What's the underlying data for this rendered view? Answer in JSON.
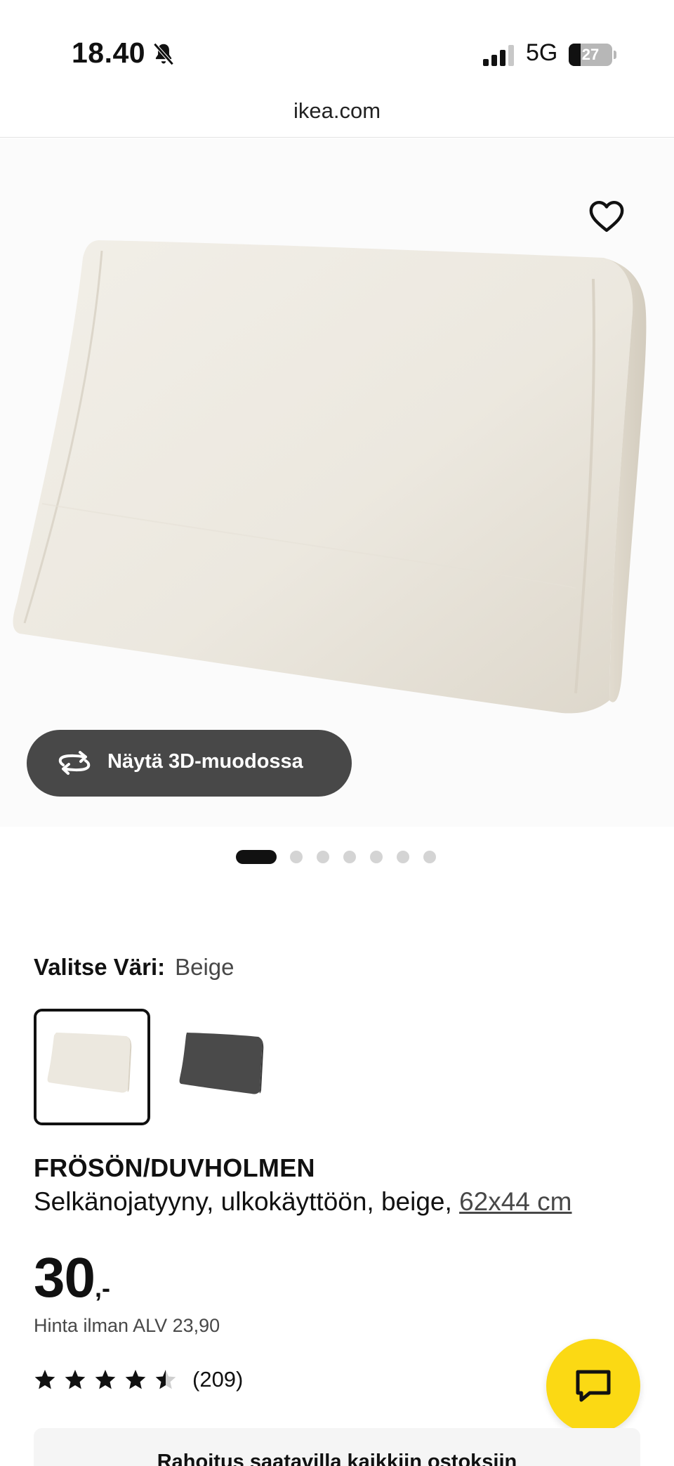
{
  "status_bar": {
    "time": "18.40",
    "network": "5G",
    "battery": "27",
    "battery_level_percent": 27,
    "icons": [
      "bell-slash-icon",
      "signal-icon",
      "battery-icon"
    ]
  },
  "browser": {
    "url": "ikea.com"
  },
  "gallery": {
    "view_3d_label": "Näytä 3D-muodossa",
    "dot_count": 7,
    "active_dot": 0,
    "icons": [
      "heart-icon",
      "rotate-3d-icon"
    ]
  },
  "color_picker": {
    "label": "Valitse Väri:",
    "selected": "Beige",
    "swatches": [
      {
        "name": "beige",
        "color": "#ece8df",
        "selected": true
      },
      {
        "name": "dark-grey",
        "color": "#4a4a4a",
        "selected": false
      }
    ]
  },
  "product": {
    "name": "FRÖSÖN/DUVHOLMEN",
    "description": "Selkänojatyyny, ulkokäyttöön, beige,",
    "size": "62x44 cm",
    "price": "30",
    "price_suffix": ",-",
    "price_vat": "Hinta ilman ALV 23,90",
    "rating": 4.5,
    "rating_max": 5,
    "review_count": "(209)"
  },
  "chat": {
    "icon": "chat-icon",
    "color": "#fbd914"
  },
  "finance_banner": {
    "text": "Rahoitus saatavilla kaikkiin ostoksiin"
  }
}
